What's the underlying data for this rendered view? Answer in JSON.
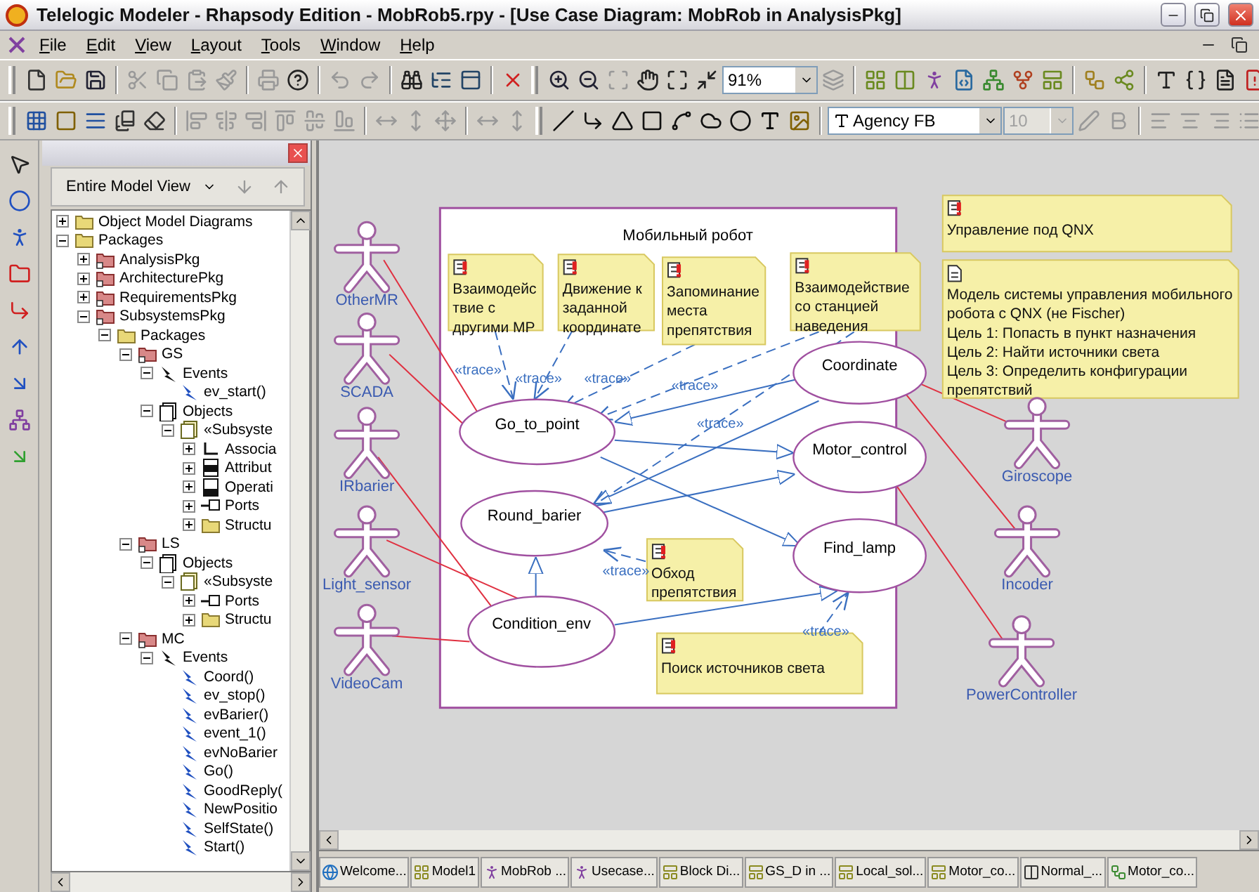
{
  "window": {
    "title": "Telelogic Modeler - Rhapsody Edition - MobRob5.rpy - [Use Case Diagram: MobRob in AnalysisPkg]"
  },
  "menu": [
    "File",
    "Edit",
    "View",
    "Layout",
    "Tools",
    "Window",
    "Help"
  ],
  "toolbar": {
    "zoom": "91%",
    "font": "Agency FB",
    "font_size": {
      "value": "10",
      "disabled": true
    }
  },
  "browser": {
    "view": "Entire Model View",
    "tree": [
      {
        "label": "Object Model Diagrams",
        "kind": "folder",
        "expanded": false
      },
      {
        "label": "Packages",
        "kind": "folder",
        "expanded": true,
        "children": [
          {
            "label": "AnalysisPkg",
            "kind": "package",
            "expanded": false
          },
          {
            "label": "ArchitecturePkg",
            "kind": "package",
            "expanded": false
          },
          {
            "label": "RequirementsPkg",
            "kind": "package",
            "expanded": false
          },
          {
            "label": "SubsystemsPkg",
            "kind": "package",
            "expanded": true,
            "children": [
              {
                "label": "Packages",
                "kind": "folder",
                "expanded": true,
                "children": [
                  {
                    "label": "GS",
                    "kind": "package",
                    "expanded": true,
                    "children": [
                      {
                        "label": "Events",
                        "kind": "events",
                        "expanded": true,
                        "children": [
                          {
                            "label": "ev_start()",
                            "kind": "event"
                          }
                        ]
                      },
                      {
                        "label": "Objects",
                        "kind": "objects",
                        "expanded": true,
                        "children": [
                          {
                            "label": "«Subsyste",
                            "kind": "object",
                            "expanded": true,
                            "children": [
                              {
                                "label": "Associa",
                                "kind": "association",
                                "expanded": false
                              },
                              {
                                "label": "Attribut",
                                "kind": "attributes",
                                "expanded": false
                              },
                              {
                                "label": "Operati",
                                "kind": "operations",
                                "expanded": false
                              },
                              {
                                "label": "Ports",
                                "kind": "ports",
                                "expanded": false
                              },
                              {
                                "label": "Structu",
                                "kind": "folder",
                                "expanded": false
                              }
                            ]
                          }
                        ]
                      }
                    ]
                  },
                  {
                    "label": "LS",
                    "kind": "package",
                    "expanded": true,
                    "children": [
                      {
                        "label": "Objects",
                        "kind": "objects",
                        "expanded": true,
                        "children": [
                          {
                            "label": "«Subsyste",
                            "kind": "object",
                            "expanded": true,
                            "children": [
                              {
                                "label": "Ports",
                                "kind": "ports",
                                "expanded": false
                              },
                              {
                                "label": "Structu",
                                "kind": "folder",
                                "expanded": false
                              }
                            ]
                          }
                        ]
                      }
                    ]
                  },
                  {
                    "label": "MC",
                    "kind": "package",
                    "expanded": true,
                    "children": [
                      {
                        "label": "Events",
                        "kind": "events",
                        "expanded": true,
                        "children": [
                          {
                            "label": "Coord()",
                            "kind": "event"
                          },
                          {
                            "label": "ev_stop()",
                            "kind": "event"
                          },
                          {
                            "label": "evBarier()",
                            "kind": "event"
                          },
                          {
                            "label": "event_1()",
                            "kind": "event"
                          },
                          {
                            "label": "evNoBarier",
                            "kind": "event"
                          },
                          {
                            "label": "Go()",
                            "kind": "event"
                          },
                          {
                            "label": "GoodReply(",
                            "kind": "event"
                          },
                          {
                            "label": "NewPositio",
                            "kind": "event"
                          },
                          {
                            "label": "SelfState()",
                            "kind": "event"
                          },
                          {
                            "label": "Start()",
                            "kind": "event"
                          }
                        ]
                      }
                    ]
                  }
                ]
              }
            ]
          }
        ]
      }
    ]
  },
  "diagram": {
    "boundary_title": "Мобильный робот",
    "use_cases": [
      "Go_to_point",
      "Coordinate",
      "Motor_control",
      "Round_barier",
      "Find_lamp",
      "Condition_env"
    ],
    "actors": [
      "OtherMR",
      "SCADA",
      "IRbarier",
      "Light_sensor",
      "VideoCam",
      "Giroscope",
      "Incoder",
      "PowerController"
    ],
    "notes": [
      {
        "kind": "requirement",
        "lines": [
          "Взаимодейс",
          "твие с",
          "другими МР"
        ]
      },
      {
        "kind": "requirement",
        "lines": [
          "Движение к",
          "заданной",
          "координате"
        ]
      },
      {
        "kind": "requirement",
        "lines": [
          "Запоминание",
          "места",
          "препятствия"
        ]
      },
      {
        "kind": "requirement",
        "lines": [
          "Взаимодействие",
          "со станцией",
          "наведения"
        ]
      },
      {
        "kind": "requirement",
        "lines": [
          "Обход",
          "препятствия"
        ]
      },
      {
        "kind": "requirement",
        "lines": [
          "Поиск источников света"
        ]
      },
      {
        "kind": "requirement",
        "lines": [
          "Управление под QNX"
        ]
      },
      {
        "kind": "comment",
        "lines": [
          "Модель системы управления мобильного",
          "робота с QNX (не Fischer)",
          "Цель 1:  Попасть в пункт назначения",
          "Цель 2:  Найти источники света",
          "Цель 3:  Определить конфигурации",
          "препятствий"
        ]
      }
    ],
    "trace_labels": [
      "«trace»",
      "«trace»",
      "«trace»",
      "«trace»",
      "«trace»",
      "«trace»",
      "«trace»"
    ]
  },
  "tabs": [
    {
      "label": "Welcome...",
      "kind": "web",
      "selected": false
    },
    {
      "label": "Model1",
      "kind": "model",
      "selected": false
    },
    {
      "label": "MobRob ...",
      "kind": "usecase",
      "selected": false
    },
    {
      "label": "Usecase...",
      "kind": "usecase",
      "selected": false
    },
    {
      "label": "Block Di...",
      "kind": "block",
      "selected": false
    },
    {
      "label": "GS_D in ...",
      "kind": "block",
      "selected": false
    },
    {
      "label": "Local_sol...",
      "kind": "block",
      "selected": false
    },
    {
      "label": "Motor_co...",
      "kind": "block",
      "selected": false
    },
    {
      "label": "Normal_...",
      "kind": "sequence",
      "selected": false
    },
    {
      "label": "Motor_co...",
      "kind": "statechart",
      "selected": false
    }
  ]
}
